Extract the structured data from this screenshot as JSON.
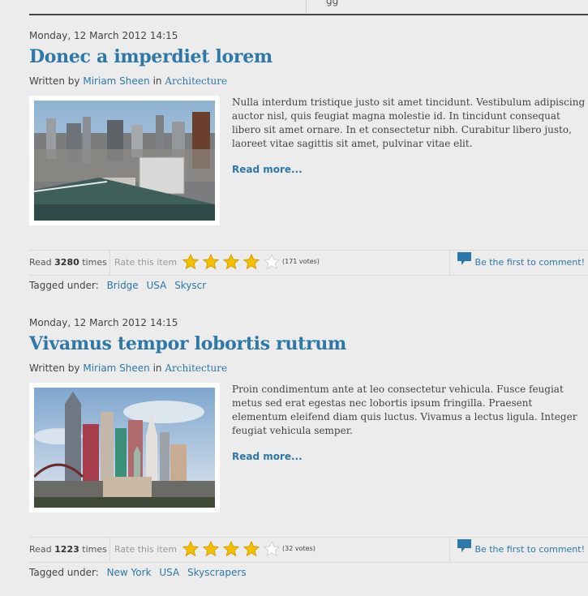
{
  "top_stub": "gg",
  "articles": [
    {
      "date": "Monday, 12 March 2012 14:15",
      "title": "Donec a imperdiet lorem",
      "written_by": "Written by",
      "author": "Miriam Sheen",
      "in": "in",
      "category": "Architecture",
      "excerpt": "Nulla interdum tristique justo sit amet tincidunt. Vestibulum adipiscing auctor nisl, quis feugiat magna molestie id. In tincidunt consequat libero sit amet ornare. In et consectetur nibh. Curabitur libero justo, laoreet vitae sagittis sit amet, pulvinar vitae elit.",
      "read_more": "Read more...",
      "read_prefix": "Read",
      "read_count": "3280",
      "read_suffix": "times",
      "rate_label": "Rate this item",
      "rating": 4,
      "max_rating": 5,
      "votes": "(171 votes)",
      "comment_link": "Be the first to comment!",
      "tagged_label": "Tagged under:",
      "tags": [
        "Bridge",
        "USA",
        "Skyscr"
      ],
      "image_icon": "city-skyline-photo"
    },
    {
      "date": "Monday, 12 March 2012 14:15",
      "title": "Vivamus tempor lobortis rutrum",
      "written_by": "Written by",
      "author": "Miriam Sheen",
      "in": "in",
      "category": "Architecture",
      "excerpt": "Proin condimentum ante at leo consectetur vehicula. Fusce feugiat metus sed erat egestas nec lobortis ipsum fringilla. Praesent elementum eleifend diam quis luctus. Vivamus a lectus ligula. Integer feugiat vehicula semper.",
      "read_more": "Read more...",
      "read_prefix": "Read",
      "read_count": "1223",
      "read_suffix": "times",
      "rate_label": "Rate this item",
      "rating": 4,
      "max_rating": 5,
      "votes": "(32 votes)",
      "comment_link": "Be the first to comment!",
      "tagged_label": "Tagged under:",
      "tags": [
        "New York",
        "USA",
        "Skyscrapers"
      ],
      "image_icon": "las-vegas-skyline-photo"
    }
  ],
  "colors": {
    "link": "#2d78a8",
    "star_on": "#f2c200",
    "star_off": "#ffffff"
  }
}
